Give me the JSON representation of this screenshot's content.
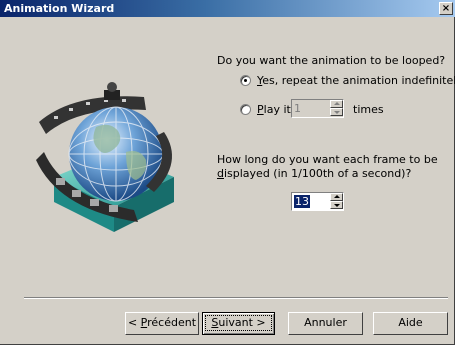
{
  "window": {
    "title": "Animation Wizard",
    "close_label": "×"
  },
  "loop": {
    "question": "Do you want the animation to be looped?",
    "option_repeat": {
      "mnemonic": "Y",
      "rest": "es, repeat the animation indefinitely",
      "selected": true
    },
    "option_play": {
      "mnemonic": "P",
      "rest": "lay it",
      "selected": false
    },
    "play_count": "1",
    "times_label": "times"
  },
  "frame": {
    "question_line1": "How long do you want each frame to be",
    "question_line2_mnemonic": "d",
    "question_line2_rest": "isplayed (in 1/100th of a second)?",
    "duration": "13"
  },
  "buttons": {
    "back": {
      "prefix": "< ",
      "mnemonic": "P",
      "rest": "récédent"
    },
    "next": {
      "mnemonic": "S",
      "rest": "uivant >"
    },
    "cancel": "Annuler",
    "help": "Aide"
  },
  "icons": {
    "artwork": "globe-with-film-reel-icon",
    "close": "close-icon"
  },
  "colors": {
    "titlebar_start": "#0a246a",
    "titlebar_end": "#a6caf0",
    "face": "#d4d0c8",
    "selection": "#0a246a"
  }
}
